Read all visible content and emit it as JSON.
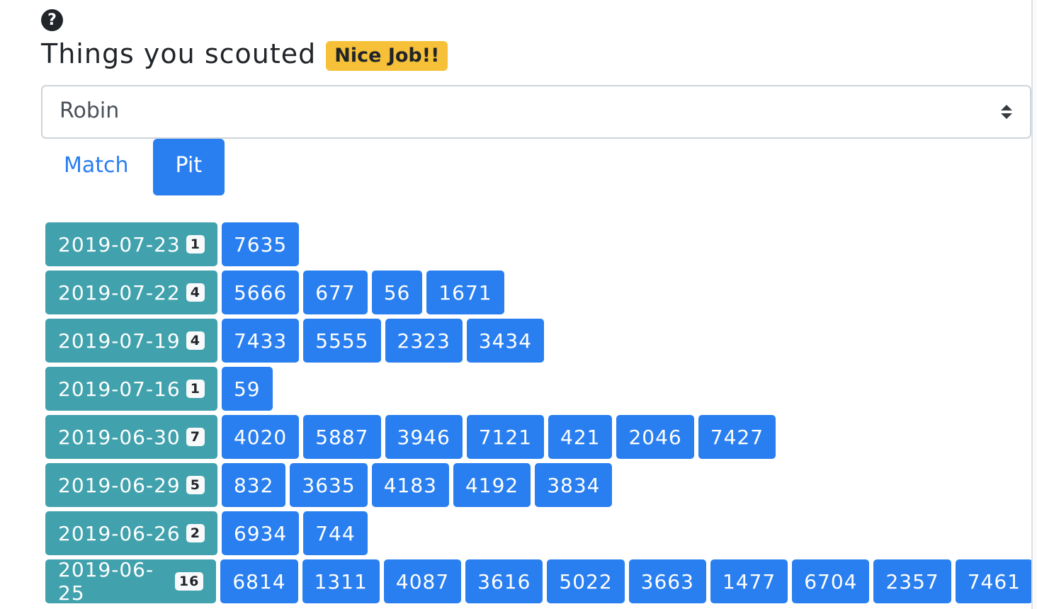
{
  "help_icon": "question-circle-icon",
  "title": "Things you scouted",
  "badge": "Nice Job!!",
  "select": {
    "value": "Robin"
  },
  "tabs": [
    {
      "label": "Match",
      "active": false
    },
    {
      "label": "Pit",
      "active": true
    }
  ],
  "colors": {
    "primary": "#2a7ff0",
    "date": "#41a2ad",
    "badge": "#f6c038"
  },
  "rows": [
    {
      "date": "2019-07-23",
      "count": "1",
      "teams": [
        "7635"
      ]
    },
    {
      "date": "2019-07-22",
      "count": "4",
      "teams": [
        "5666",
        "677",
        "56",
        "1671"
      ]
    },
    {
      "date": "2019-07-19",
      "count": "4",
      "teams": [
        "7433",
        "5555",
        "2323",
        "3434"
      ]
    },
    {
      "date": "2019-07-16",
      "count": "1",
      "teams": [
        "59"
      ]
    },
    {
      "date": "2019-06-30",
      "count": "7",
      "teams": [
        "4020",
        "5887",
        "3946",
        "7121",
        "421",
        "2046",
        "7427"
      ]
    },
    {
      "date": "2019-06-29",
      "count": "5",
      "teams": [
        "832",
        "3635",
        "4183",
        "4192",
        "3834"
      ]
    },
    {
      "date": "2019-06-26",
      "count": "2",
      "teams": [
        "6934",
        "744"
      ]
    },
    {
      "date": "2019-06-25",
      "count": "16",
      "teams": [
        "6814",
        "1311",
        "4087",
        "3616",
        "5022",
        "3663",
        "1477",
        "6704",
        "2357",
        "7461"
      ]
    }
  ]
}
